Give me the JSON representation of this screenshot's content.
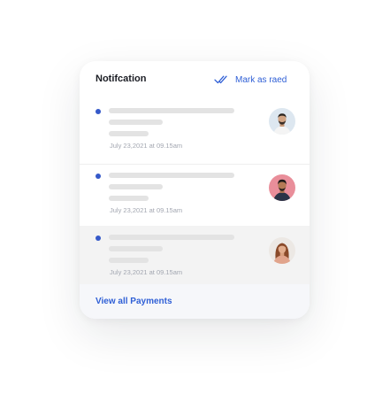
{
  "card": {
    "title": "Notifcation",
    "mark_read_label": "Mark as raed",
    "footer_link": "View all Payments"
  },
  "notifications": [
    {
      "unread": true,
      "time": "July 23,2021 at 09.15am",
      "avatar": "man-with-beard-light-bg"
    },
    {
      "unread": true,
      "time": "July 23,2021 at 09.15am",
      "avatar": "man-pink-bg"
    },
    {
      "unread": true,
      "time": "July 23,2021 at 09.15am",
      "avatar": "woman-light-bg"
    }
  ],
  "colors": {
    "accent": "#2f5fd6",
    "unread_dot": "#3559c9",
    "placeholder": "#e3e3e3",
    "selected_row": "#f3f3f3"
  }
}
